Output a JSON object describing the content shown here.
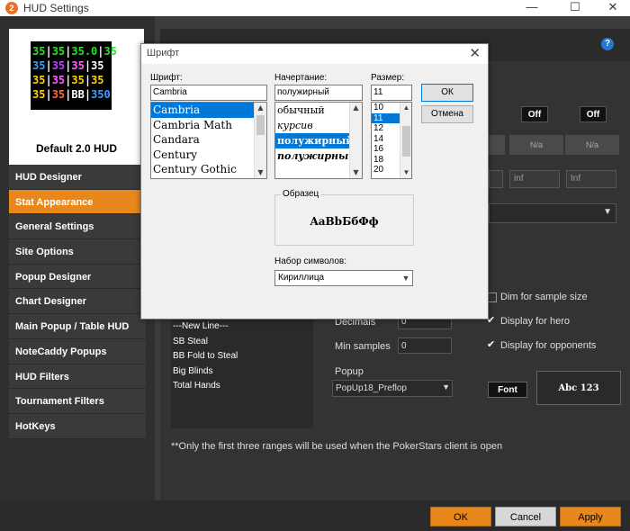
{
  "window": {
    "title": "HUD Settings",
    "app_icon_label": "2",
    "minimize": "—",
    "maximize": "☐",
    "close": "✕"
  },
  "hud_preview": {
    "name": "Default 2.0 HUD",
    "rows": [
      [
        {
          "t": "35",
          "c": "#2de02d"
        },
        {
          "t": "|",
          "c": "#fff"
        },
        {
          "t": "35",
          "c": "#2de02d"
        },
        {
          "t": "|",
          "c": "#fff"
        },
        {
          "t": "35.0",
          "c": "#2de02d"
        },
        {
          "t": "|",
          "c": "#fff"
        },
        {
          "t": "35",
          "c": "#2de02d"
        }
      ],
      [
        {
          "t": "35",
          "c": "#3aa0ff"
        },
        {
          "t": "|",
          "c": "#fff"
        },
        {
          "t": "35",
          "c": "#c040ff"
        },
        {
          "t": "|",
          "c": "#fff"
        },
        {
          "t": "35",
          "c": "#ff60ff"
        },
        {
          "t": "|",
          "c": "#fff"
        },
        {
          "t": "35",
          "c": "#fff"
        }
      ],
      [
        {
          "t": "35",
          "c": "#ffd400"
        },
        {
          "t": "|",
          "c": "#fff"
        },
        {
          "t": "35",
          "c": "#ff60ff"
        },
        {
          "t": "|",
          "c": "#fff"
        },
        {
          "t": "35",
          "c": "#ffd400"
        },
        {
          "t": "|",
          "c": "#fff"
        },
        {
          "t": "35",
          "c": "#ffd400"
        }
      ],
      [
        {
          "t": "35",
          "c": "#ffd400"
        },
        {
          "t": "|",
          "c": "#fff"
        },
        {
          "t": "35",
          "c": "#ff6a3a"
        },
        {
          "t": "|",
          "c": "#fff"
        },
        {
          "t": "BB",
          "c": "#fff"
        },
        {
          "t": "|",
          "c": "#fff"
        },
        {
          "t": "350",
          "c": "#3aa0ff"
        }
      ]
    ]
  },
  "nav": [
    {
      "label": "HUD Designer",
      "active": false
    },
    {
      "label": "Stat Appearance",
      "active": true
    },
    {
      "label": "General Settings",
      "active": false
    },
    {
      "label": "Site Options",
      "active": false
    },
    {
      "label": "Popup Designer",
      "active": false
    },
    {
      "label": "Chart Designer",
      "active": false
    },
    {
      "label": "Main Popup / Table HUD",
      "active": false
    },
    {
      "label": "NoteCaddy Popups",
      "active": false
    },
    {
      "label": "HUD Filters",
      "active": false
    },
    {
      "label": "Tournament Filters",
      "active": false
    },
    {
      "label": "HotKeys",
      "active": false
    }
  ],
  "settings": {
    "off1": "Off",
    "off2": "Off",
    "na": "N/a",
    "inf1": "inf",
    "inf2": "Inf",
    "stat_list": [
      "---New Line---",
      "SB Steal",
      "BB Fold to Steal",
      "Big Blinds",
      "Total Hands"
    ],
    "decimals_label": "Decimals",
    "decimals_value": "0",
    "min_samples_label": "Min samples",
    "min_samples_value": "0",
    "dim_label": "Dim for sample size",
    "display_hero_label": "Display for hero",
    "display_opponents_label": "Display for opponents",
    "popup_label": "Popup",
    "popup_value": "PopUp18_Preflop",
    "font_button": "Font",
    "font_preview": "Abc 123",
    "note": "**Only the first three ranges will be used when the PokerStars client is open"
  },
  "buttons": {
    "ok": "OK",
    "cancel": "Cancel",
    "apply": "Apply"
  },
  "dialog": {
    "title": "Шрифт",
    "font_label": "Шрифт:",
    "font_value": "Cambria",
    "fonts": [
      "Cambria",
      "Cambria Math",
      "Candara",
      "Century",
      "Century Gothic"
    ],
    "style_label": "Начертание:",
    "style_value": "полужирный",
    "styles": [
      "обычный",
      "курсив",
      "полужирный",
      "полужирный"
    ],
    "size_label": "Размер:",
    "size_value": "11",
    "sizes": [
      "10",
      "11",
      "12",
      "14",
      "16",
      "18",
      "20"
    ],
    "ok": "ОК",
    "cancel": "Отмена",
    "sample_label": "Образец",
    "sample_text": "AaBbБбФф",
    "charset_label": "Набор символов:",
    "charset_value": "Кириллица"
  }
}
